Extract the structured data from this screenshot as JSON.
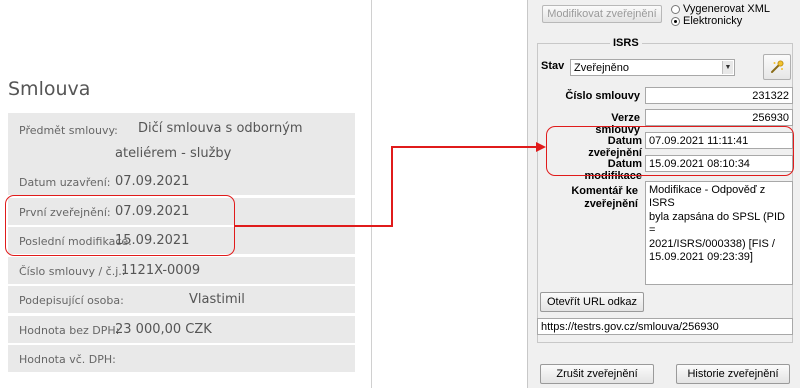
{
  "contract": {
    "title": "Smlouva",
    "rows": [
      {
        "label": "Předmět smlouvy:",
        "value_line1": "Dičí smlouva s odborným",
        "value_line2": "ateliérem - služby"
      },
      {
        "label": "Datum uzavření:",
        "value": "07.09.2021"
      },
      {
        "label": "První zveřejnění:",
        "value": "07.09.2021"
      },
      {
        "label": "Poslední modifikace:",
        "value": "15.09.2021"
      },
      {
        "label": "Číslo smlouvy / č.j.:",
        "value": "1121X-0009"
      },
      {
        "label": "Podepisující osoba:",
        "value": "Vlastimil"
      },
      {
        "label": "Hodnota bez DPH:",
        "value": "23 000,00 CZK"
      },
      {
        "label": "Hodnota vč. DPH:",
        "value": ""
      }
    ]
  },
  "form": {
    "modify_button": "Modifikovat zveřejnění",
    "radio_xml": "Vygenerovat XML",
    "radio_electronic": "Elektronicky",
    "group_title": "ISRS",
    "stav_label": "Stav",
    "stav_value": "Zveřejněno",
    "cislo_label": "Číslo smlouvy",
    "cislo_value": "231322",
    "verze_label": "Verze smlouvy",
    "verze_value": "256930",
    "datum_zver_label": "Datum zveřejnění",
    "datum_zver_value": "07.09.2021 11:11:41",
    "datum_mod_label": "Datum modifikace",
    "datum_mod_value": "15.09.2021 08:10:34",
    "komentar_label_1": "Komentář ke",
    "komentar_label_2": "zveřejnění",
    "komentar_value": "Modifikace - Odpověď z ISRS\nbyla zapsána do SPSL (PID =\n2021/ISRS/000338) [FIS /\n15.09.2021 09:23:39]",
    "open_url_button": "Otevřít URL odkaz",
    "url_value": "https://testrs.gov.cz/smlouva/256930",
    "cancel_button": "Zrušit zveřejnění",
    "history_button": "Historie zveřejnění"
  },
  "colors": {
    "highlight": "#e01b1b",
    "row_bg": "#e9e9e9",
    "panel_bg": "#f0f0f0"
  }
}
